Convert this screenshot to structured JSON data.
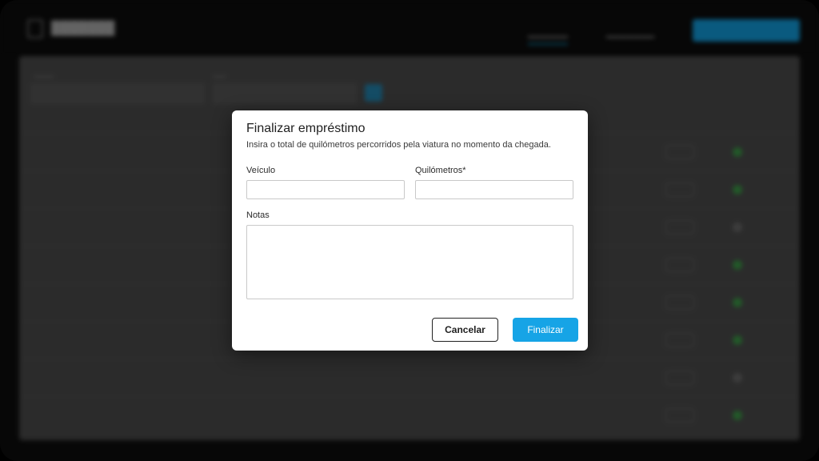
{
  "modal": {
    "title": "Finalizar empréstimo",
    "description": "Insira o total de quilómetros percorridos pela viatura no momento da chegada.",
    "vehicle_label": "Veículo",
    "vehicle_value": "",
    "km_label": "Quilómetros*",
    "km_value": "",
    "notes_label": "Notas",
    "notes_value": "",
    "cancel_label": "Cancelar",
    "finish_label": "Finalizar"
  },
  "colors": {
    "primary": "#16a4e6",
    "status_green": "#2f7d39"
  }
}
